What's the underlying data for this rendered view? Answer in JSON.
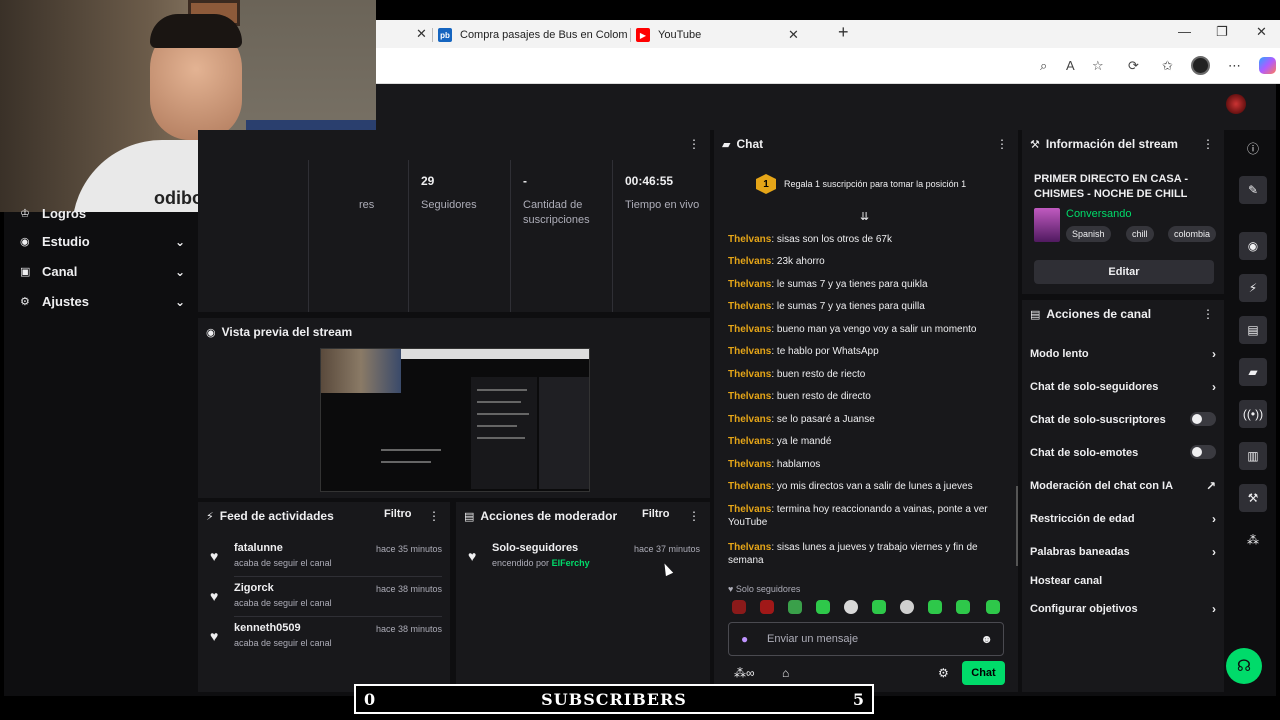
{
  "browser": {
    "tabs": [
      {
        "label": "Compra pasajes de Bus en Colom",
        "favicon": "pb",
        "favicon_color": "#1565c0"
      },
      {
        "label": "YouTube",
        "favicon": "youtube-icon",
        "favicon_color": "#ff0000"
      }
    ]
  },
  "webcam": {
    "shirt_text": "sodibo"
  },
  "leftnav": {
    "items": [
      {
        "label": "Logros",
        "icon": "trophy-icon"
      },
      {
        "label": "Estudio",
        "icon": "studio-icon"
      },
      {
        "label": "Canal",
        "icon": "channel-icon"
      },
      {
        "label": "Ajustes",
        "icon": "gear-icon"
      }
    ]
  },
  "stats": {
    "partial_label": "res",
    "items": [
      {
        "value": "29",
        "label": "Seguidores"
      },
      {
        "value": "-",
        "label": "Cantidad de suscripciones"
      },
      {
        "value": "00:46:55",
        "label": "Tiempo en vivo"
      }
    ]
  },
  "preview": {
    "title": "Vista previa del stream"
  },
  "feed": {
    "title": "Feed de actividades",
    "filter_label": "Filtro",
    "rows": [
      {
        "name": "fatalunne",
        "sub": "acaba de seguir el canal",
        "time": "hace 35 minutos"
      },
      {
        "name": "Zigorck",
        "sub": "acaba de seguir el canal",
        "time": "hace 38 minutos"
      },
      {
        "name": "kenneth0509",
        "sub": "acaba de seguir el canal",
        "time": "hace 38 minutos"
      }
    ]
  },
  "mod": {
    "title": "Acciones de moderador",
    "filter_label": "Filtro",
    "rows": [
      {
        "name": "Solo-seguidores",
        "sub_prefix": "encendido por",
        "sub_user": "ElFerchy",
        "time": "hace 37 minutos"
      }
    ]
  },
  "chat": {
    "title": "Chat",
    "gift_rank": "1",
    "gift_text": "Regala 1 suscripción para tomar la posición 1",
    "messages": [
      {
        "user": "Thelvans",
        "text": "sisas son los otros de 67k"
      },
      {
        "user": "Thelvans",
        "text": "23k ahorro"
      },
      {
        "user": "Thelvans",
        "text": "le sumas 7 y ya tienes para quikla"
      },
      {
        "user": "Thelvans",
        "text": "le sumas 7 y ya tienes para quilla"
      },
      {
        "user": "Thelvans",
        "text": "bueno man ya vengo voy a salir un momento"
      },
      {
        "user": "Thelvans",
        "text": "te hablo por WhatsApp"
      },
      {
        "user": "Thelvans",
        "text": "buen resto de riecto"
      },
      {
        "user": "Thelvans",
        "text": "buen resto de directo"
      },
      {
        "user": "Thelvans",
        "text": "se lo pasaré a Juanse"
      },
      {
        "user": "Thelvans",
        "text": "ya le mandé"
      },
      {
        "user": "Thelvans",
        "text": "hablamos"
      },
      {
        "user": "Thelvans",
        "text": "yo mis directos van a salir de lunes a jueves"
      },
      {
        "user": "Thelvans",
        "text": "termina hoy reaccionando a vainas, ponte a ver YouTube"
      },
      {
        "user": "Thelvans",
        "text": "sisas lunes a jueves y trabajo viernes y fin de semana"
      }
    ],
    "mode_label": "Solo seguidores",
    "input_placeholder": "Enviar un mensaje",
    "send_label": "Chat",
    "username_color": "#e5a518"
  },
  "info": {
    "title": "Información del stream",
    "stream_title": "PRIMER DIRECTO EN CASA - CHISMES - NOCHE DE CHILL",
    "category": "Conversando",
    "tags": [
      "Spanish",
      "chill",
      "colombia"
    ],
    "edit_label": "Editar"
  },
  "actions": {
    "title": "Acciones de canal",
    "items": [
      {
        "label": "Modo lento",
        "control": "chevron"
      },
      {
        "label": "Chat de solo-seguidores",
        "control": "chevron"
      },
      {
        "label": "Chat de solo-suscriptores",
        "control": "toggle"
      },
      {
        "label": "Chat de solo-emotes",
        "control": "toggle"
      },
      {
        "label": "Moderación del chat con IA",
        "control": "external"
      },
      {
        "label": "Restricción de edad",
        "control": "chevron"
      },
      {
        "label": "Palabras baneadas",
        "control": "chevron"
      },
      {
        "label": "Hostear canal",
        "control": "none"
      },
      {
        "label": "Configurar objetivos",
        "control": "chevron"
      }
    ]
  },
  "overlay": {
    "left": "0",
    "label": "SUBSCRIBERS",
    "right": "5"
  },
  "colors": {
    "accent_green": "#00db6a",
    "bg": "#0e0e10",
    "panel": "#18181b"
  }
}
